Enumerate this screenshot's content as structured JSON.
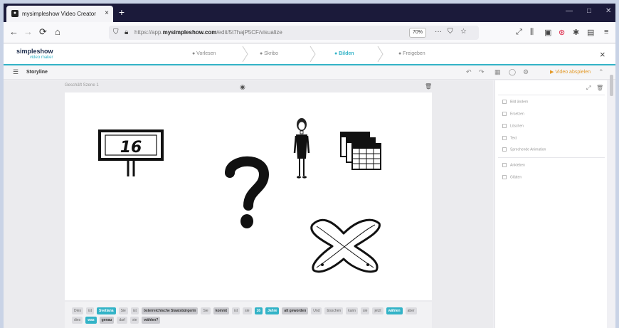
{
  "browser": {
    "tab_title": "mysimpleshow Video Creator",
    "tab_close": "×",
    "new_tab": "+",
    "url_prefix": "https://app.",
    "url_domain": "mysimpleshow.com",
    "url_path": "/edit/5t7hajP5CF/visualize",
    "zoom": "70%",
    "win_min": "—",
    "win_max": "□",
    "win_close": "✕",
    "nav_back": "←",
    "nav_forward": "→",
    "nav_reload": "⟳",
    "nav_home": "⌂"
  },
  "app": {
    "logo_main": "simpleshow",
    "logo_sub": "video maker",
    "steps": [
      {
        "label": "● Vorlesen"
      },
      {
        "label": "● Skribo"
      },
      {
        "label": "● Bilden"
      },
      {
        "label": "● Freigeben"
      }
    ],
    "close": "×",
    "toolbar_label": "Storyline",
    "play_label": "Video abspielen"
  },
  "canvas": {
    "header_left": "Geschäft Szene 1",
    "sign_number": "16"
  },
  "textbar": {
    "chips": [
      {
        "text": "Dies",
        "style": "plain"
      },
      {
        "text": "ist",
        "style": "plain"
      },
      {
        "text": "Svetlana",
        "style": "hl"
      },
      {
        "text": "Sie",
        "style": "plain"
      },
      {
        "text": "ist",
        "style": "plain"
      },
      {
        "text": "österreichische Staatsbürgerin",
        "style": "dark"
      },
      {
        "text": "Sie",
        "style": "plain"
      },
      {
        "text": "kommt",
        "style": "dark"
      },
      {
        "text": "ist",
        "style": "plain"
      },
      {
        "text": "sie",
        "style": "plain"
      },
      {
        "text": "16",
        "style": "hl"
      },
      {
        "text": "Jahre",
        "style": "hl"
      },
      {
        "text": "alt geworden",
        "style": "dark"
      },
      {
        "text": "Und",
        "style": "plain"
      },
      {
        "text": "bisschen",
        "style": "plain"
      },
      {
        "text": "kann",
        "style": "plain"
      },
      {
        "text": "sie",
        "style": "plain"
      },
      {
        "text": "jetzt",
        "style": "plain"
      },
      {
        "text": "wählen",
        "style": "hl"
      },
      {
        "text": "aber",
        "style": "plain"
      },
      {
        "text": "dies",
        "style": "plain"
      },
      {
        "text": "was",
        "style": "hl"
      },
      {
        "text": "genau",
        "style": "dark"
      },
      {
        "text": "darf",
        "style": "plain"
      },
      {
        "text": "sie",
        "style": "plain"
      },
      {
        "text": "wählen?",
        "style": "dark"
      }
    ]
  },
  "panel": {
    "rows": [
      "Bild ändern",
      "Ersetzen",
      "Löschen",
      "Text",
      "Sprechende Animation",
      "Ankleben",
      "Glätten"
    ]
  }
}
